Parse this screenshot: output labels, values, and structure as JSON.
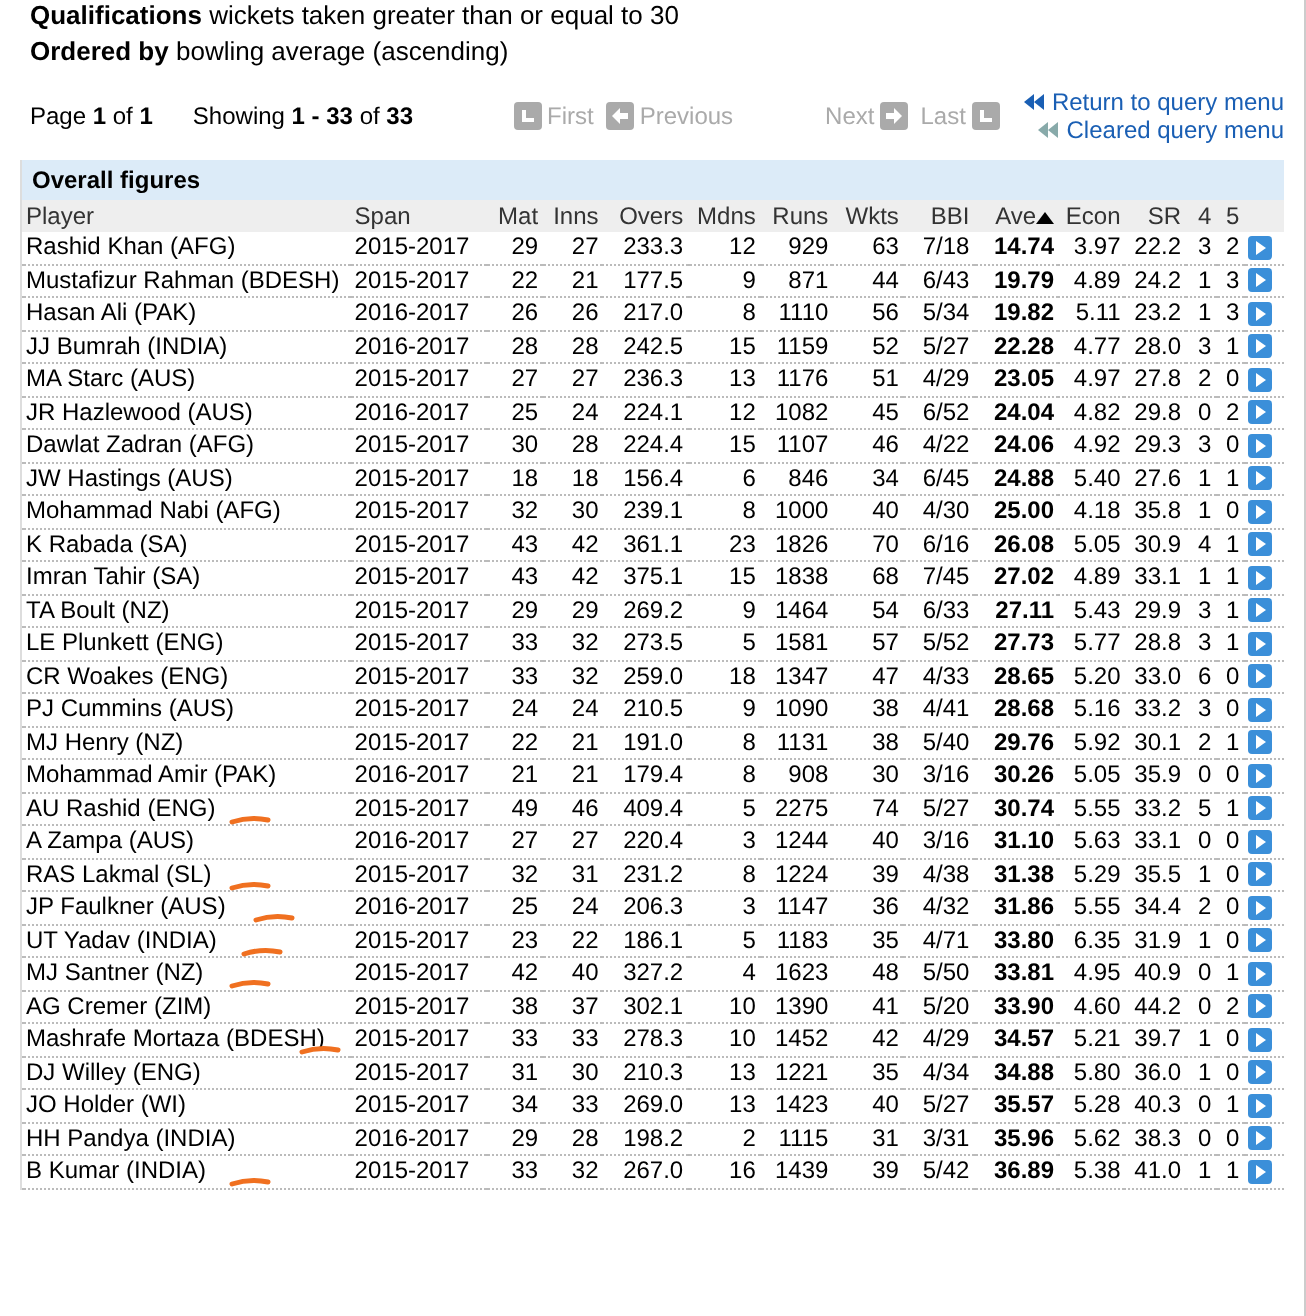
{
  "qualifications": {
    "label": "Qualifications",
    "text": "wickets taken greater than or equal to 30"
  },
  "ordered_by": {
    "label": "Ordered by",
    "text": "bowling average (ascending)"
  },
  "pagination": {
    "page": "Page **1** of **1**",
    "showing": "Showing **1 - 33** of **33**",
    "nav": [
      {
        "label": "First",
        "kind": "first",
        "disabled": true
      },
      {
        "label": "Previous",
        "kind": "previous",
        "disabled": true
      },
      {
        "label": "Next",
        "kind": "next",
        "disabled": true
      },
      {
        "label": "Last",
        "kind": "last",
        "disabled": true
      }
    ]
  },
  "links": [
    "Return to query menu",
    "Cleared query menu"
  ],
  "table": {
    "title": "Overall figures",
    "columns": [
      {
        "label": "Player",
        "sorted": false
      },
      {
        "label": "Span",
        "sorted": false
      },
      {
        "label": "Mat",
        "sorted": false
      },
      {
        "label": "Inns",
        "sorted": false
      },
      {
        "label": "Overs",
        "sorted": false
      },
      {
        "label": "Mdns",
        "sorted": false
      },
      {
        "label": "Runs",
        "sorted": false
      },
      {
        "label": "Wkts",
        "sorted": false
      },
      {
        "label": "BBI",
        "sorted": false
      },
      {
        "label": "Ave",
        "sorted": true
      },
      {
        "label": "Econ",
        "sorted": false
      },
      {
        "label": "SR",
        "sorted": false
      },
      {
        "label": "4",
        "sorted": false
      },
      {
        "label": "5",
        "sorted": false
      }
    ],
    "rows": [
      {
        "cells": [
          "Rashid Khan (AFG)",
          "2015-2017",
          "29",
          "27",
          "233.3",
          "12",
          "929",
          "63",
          "7/18",
          "14.74",
          "3.97",
          "22.2",
          "3",
          "2"
        ],
        "annotated": false
      },
      {
        "cells": [
          "Mustafizur Rahman (BDESH)",
          "2015-2017",
          "22",
          "21",
          "177.5",
          "9",
          "871",
          "44",
          "6/43",
          "19.79",
          "4.89",
          "24.2",
          "1",
          "3"
        ],
        "annotated": false
      },
      {
        "cells": [
          "Hasan Ali (PAK)",
          "2016-2017",
          "26",
          "26",
          "217.0",
          "8",
          "1110",
          "56",
          "5/34",
          "19.82",
          "5.11",
          "23.2",
          "1",
          "3"
        ],
        "annotated": false
      },
      {
        "cells": [
          "JJ Bumrah (INDIA)",
          "2016-2017",
          "28",
          "28",
          "242.5",
          "15",
          "1159",
          "52",
          "5/27",
          "22.28",
          "4.77",
          "28.0",
          "3",
          "1"
        ],
        "annotated": false
      },
      {
        "cells": [
          "MA Starc (AUS)",
          "2015-2017",
          "27",
          "27",
          "236.3",
          "13",
          "1176",
          "51",
          "4/29",
          "23.05",
          "4.97",
          "27.8",
          "2",
          "0"
        ],
        "annotated": false
      },
      {
        "cells": [
          "JR Hazlewood (AUS)",
          "2016-2017",
          "25",
          "24",
          "224.1",
          "12",
          "1082",
          "45",
          "6/52",
          "24.04",
          "4.82",
          "29.8",
          "0",
          "2"
        ],
        "annotated": false
      },
      {
        "cells": [
          "Dawlat Zadran (AFG)",
          "2015-2017",
          "30",
          "28",
          "224.4",
          "15",
          "1107",
          "46",
          "4/22",
          "24.06",
          "4.92",
          "29.3",
          "3",
          "0"
        ],
        "annotated": false
      },
      {
        "cells": [
          "JW Hastings (AUS)",
          "2015-2017",
          "18",
          "18",
          "156.4",
          "6",
          "846",
          "34",
          "6/45",
          "24.88",
          "5.40",
          "27.6",
          "1",
          "1"
        ],
        "annotated": false
      },
      {
        "cells": [
          "Mohammad Nabi (AFG)",
          "2015-2017",
          "32",
          "30",
          "239.1",
          "8",
          "1000",
          "40",
          "4/30",
          "25.00",
          "4.18",
          "35.8",
          "1",
          "0"
        ],
        "annotated": false
      },
      {
        "cells": [
          "K Rabada (SA)",
          "2015-2017",
          "43",
          "42",
          "361.1",
          "23",
          "1826",
          "70",
          "6/16",
          "26.08",
          "5.05",
          "30.9",
          "4",
          "1"
        ],
        "annotated": false
      },
      {
        "cells": [
          "Imran Tahir (SA)",
          "2015-2017",
          "43",
          "42",
          "375.1",
          "15",
          "1838",
          "68",
          "7/45",
          "27.02",
          "4.89",
          "33.1",
          "1",
          "1"
        ],
        "annotated": false
      },
      {
        "cells": [
          "TA Boult (NZ)",
          "2015-2017",
          "29",
          "29",
          "269.2",
          "9",
          "1464",
          "54",
          "6/33",
          "27.11",
          "5.43",
          "29.9",
          "3",
          "1"
        ],
        "annotated": false
      },
      {
        "cells": [
          "LE Plunkett (ENG)",
          "2015-2017",
          "33",
          "32",
          "273.5",
          "5",
          "1581",
          "57",
          "5/52",
          "27.73",
          "5.77",
          "28.8",
          "3",
          "1"
        ],
        "annotated": false
      },
      {
        "cells": [
          "CR Woakes (ENG)",
          "2015-2017",
          "33",
          "32",
          "259.0",
          "18",
          "1347",
          "47",
          "4/33",
          "28.65",
          "5.20",
          "33.0",
          "6",
          "0"
        ],
        "annotated": false
      },
      {
        "cells": [
          "PJ Cummins (AUS)",
          "2015-2017",
          "24",
          "24",
          "210.5",
          "9",
          "1090",
          "38",
          "4/41",
          "28.68",
          "5.16",
          "33.2",
          "3",
          "0"
        ],
        "annotated": false
      },
      {
        "cells": [
          "MJ Henry (NZ)",
          "2015-2017",
          "22",
          "21",
          "191.0",
          "8",
          "1131",
          "38",
          "5/40",
          "29.76",
          "5.92",
          "30.1",
          "2",
          "1"
        ],
        "annotated": false
      },
      {
        "cells": [
          "Mohammad Amir (PAK)",
          "2016-2017",
          "21",
          "21",
          "179.4",
          "8",
          "908",
          "30",
          "3/16",
          "30.26",
          "5.05",
          "35.9",
          "0",
          "0"
        ],
        "annotated": false
      },
      {
        "cells": [
          "AU Rashid (ENG)",
          "2015-2017",
          "49",
          "46",
          "409.4",
          "5",
          "2275",
          "74",
          "5/27",
          "30.74",
          "5.55",
          "33.2",
          "5",
          "1"
        ],
        "annotated": true
      },
      {
        "cells": [
          "A Zampa (AUS)",
          "2016-2017",
          "27",
          "27",
          "220.4",
          "3",
          "1244",
          "40",
          "3/16",
          "31.10",
          "5.63",
          "33.1",
          "0",
          "0"
        ],
        "annotated": false
      },
      {
        "cells": [
          "RAS Lakmal (SL)",
          "2015-2017",
          "32",
          "31",
          "231.2",
          "8",
          "1224",
          "39",
          "4/38",
          "31.38",
          "5.29",
          "35.5",
          "1",
          "0"
        ],
        "annotated": true
      },
      {
        "cells": [
          "JP Faulkner (AUS)",
          "2016-2017",
          "25",
          "24",
          "206.3",
          "3",
          "1147",
          "36",
          "4/32",
          "31.86",
          "5.55",
          "34.4",
          "2",
          "0"
        ],
        "annotated": true
      },
      {
        "cells": [
          "UT Yadav (INDIA)",
          "2015-2017",
          "23",
          "22",
          "186.1",
          "5",
          "1183",
          "35",
          "4/71",
          "33.80",
          "6.35",
          "31.9",
          "1",
          "0"
        ],
        "annotated": true
      },
      {
        "cells": [
          "MJ Santner (NZ)",
          "2015-2017",
          "42",
          "40",
          "327.2",
          "4",
          "1623",
          "48",
          "5/50",
          "33.81",
          "4.95",
          "40.9",
          "0",
          "1"
        ],
        "annotated": true
      },
      {
        "cells": [
          "AG Cremer (ZIM)",
          "2015-2017",
          "38",
          "37",
          "302.1",
          "10",
          "1390",
          "41",
          "5/20",
          "33.90",
          "4.60",
          "44.2",
          "0",
          "2"
        ],
        "annotated": false
      },
      {
        "cells": [
          "Mashrafe Mortaza (BDESH)",
          "2015-2017",
          "33",
          "33",
          "278.3",
          "10",
          "1452",
          "42",
          "4/29",
          "34.57",
          "5.21",
          "39.7",
          "1",
          "0"
        ],
        "annotated": true
      },
      {
        "cells": [
          "DJ Willey (ENG)",
          "2015-2017",
          "31",
          "30",
          "210.3",
          "13",
          "1221",
          "35",
          "4/34",
          "34.88",
          "5.80",
          "36.0",
          "1",
          "0"
        ],
        "annotated": false
      },
      {
        "cells": [
          "JO Holder (WI)",
          "2015-2017",
          "34",
          "33",
          "269.0",
          "13",
          "1423",
          "40",
          "5/27",
          "35.57",
          "5.28",
          "40.3",
          "0",
          "1"
        ],
        "annotated": false
      },
      {
        "cells": [
          "HH Pandya (INDIA)",
          "2016-2017",
          "29",
          "28",
          "198.2",
          "2",
          "1115",
          "31",
          "3/31",
          "35.96",
          "5.62",
          "38.3",
          "0",
          "0"
        ],
        "annotated": false
      },
      {
        "cells": [
          "B Kumar (INDIA)",
          "2015-2017",
          "33",
          "32",
          "267.0",
          "16",
          "1439",
          "39",
          "5/42",
          "36.89",
          "5.38",
          "41.0",
          "1",
          "1"
        ],
        "annotated": true
      }
    ]
  }
}
